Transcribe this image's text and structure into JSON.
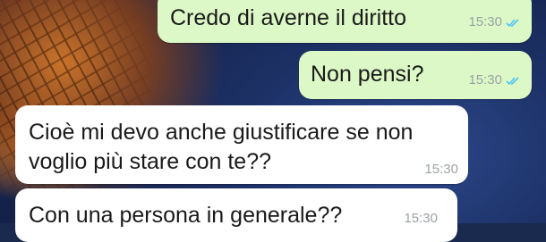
{
  "chat": {
    "messages": [
      {
        "direction": "outgoing",
        "text": "Credo di averne il diritto",
        "time": "15:30",
        "status": "read"
      },
      {
        "direction": "outgoing",
        "text": "Non pensi?",
        "time": "15:30",
        "status": "read"
      },
      {
        "direction": "incoming",
        "text": "Cioè mi devo anche giustificare se non voglio più stare con te??",
        "time": "15:30"
      },
      {
        "direction": "incoming",
        "text": "Con una persona in generale??",
        "time": "15:30"
      }
    ]
  },
  "colors": {
    "outgoing_bubble": "#dcf8c6",
    "incoming_bubble": "#ffffff",
    "read_ticks": "#4fc3f7",
    "timestamp": "#9aa3a7"
  },
  "icons": {
    "read_receipt": "double-check-icon"
  }
}
